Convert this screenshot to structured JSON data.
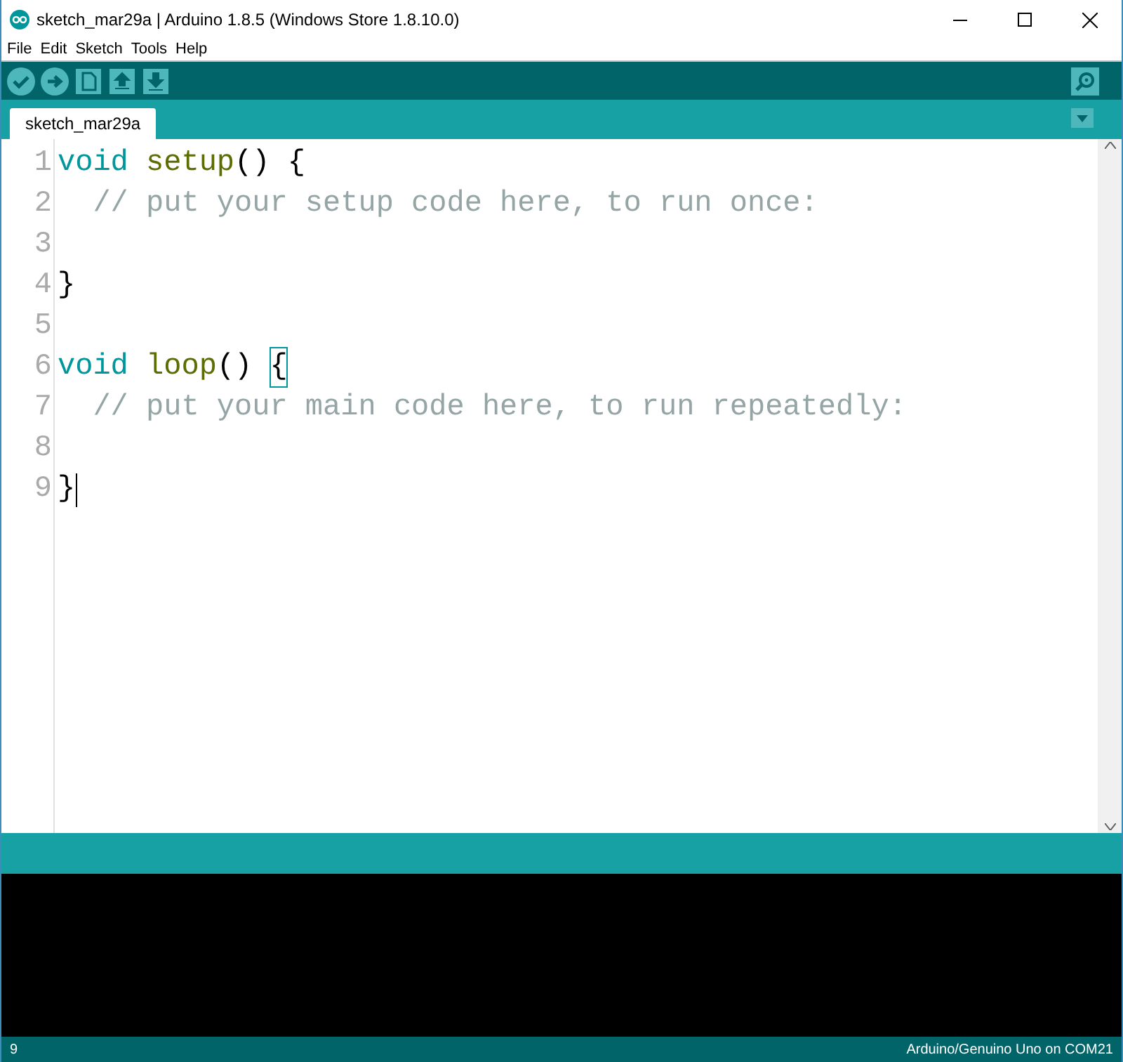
{
  "window": {
    "title": "sketch_mar29a | Arduino 1.8.5 (Windows Store 1.8.10.0)"
  },
  "menu": [
    "File",
    "Edit",
    "Sketch",
    "Tools",
    "Help"
  ],
  "toolbar": [
    {
      "kind": "verify"
    },
    {
      "kind": "upload"
    },
    {
      "kind": "new"
    },
    {
      "kind": "open"
    },
    {
      "kind": "save"
    }
  ],
  "tabs": [
    {
      "label": "sketch_mar29a",
      "selected": true
    }
  ],
  "editor": {
    "lines": [
      {
        "number": "1",
        "tokens": [
          {
            "kind": "keyword",
            "text": "void"
          },
          {
            "kind": "function",
            "text": "setup"
          },
          {
            "kind": "plain",
            "text": "()",
            "joined": true
          },
          {
            "kind": "plain",
            "text": "{"
          }
        ]
      },
      {
        "number": "2",
        "indented": true,
        "tokens": [
          {
            "kind": "comment",
            "text": "// put your setup code here, to run once:"
          }
        ]
      },
      {
        "number": "3"
      },
      {
        "number": "4",
        "tokens": [
          {
            "kind": "plain",
            "text": "}"
          }
        ]
      },
      {
        "number": "5"
      },
      {
        "number": "6",
        "tokens": [
          {
            "kind": "keyword",
            "text": "void"
          },
          {
            "kind": "function",
            "text": "loop"
          },
          {
            "kind": "plain",
            "text": "()",
            "joined": true
          },
          {
            "kind": "matched_bracket",
            "text": "{"
          }
        ]
      },
      {
        "number": "7",
        "indented": true,
        "tokens": [
          {
            "kind": "comment",
            "text": "// put your main code here, to run repeatedly:"
          }
        ]
      },
      {
        "number": "8"
      },
      {
        "number": "9",
        "tokens": [
          {
            "kind": "plain",
            "text": "}"
          }
        ],
        "cursor": true
      }
    ]
  },
  "status_bar": {
    "line": "9",
    "board": "Arduino/Genuino Uno on COM21"
  }
}
